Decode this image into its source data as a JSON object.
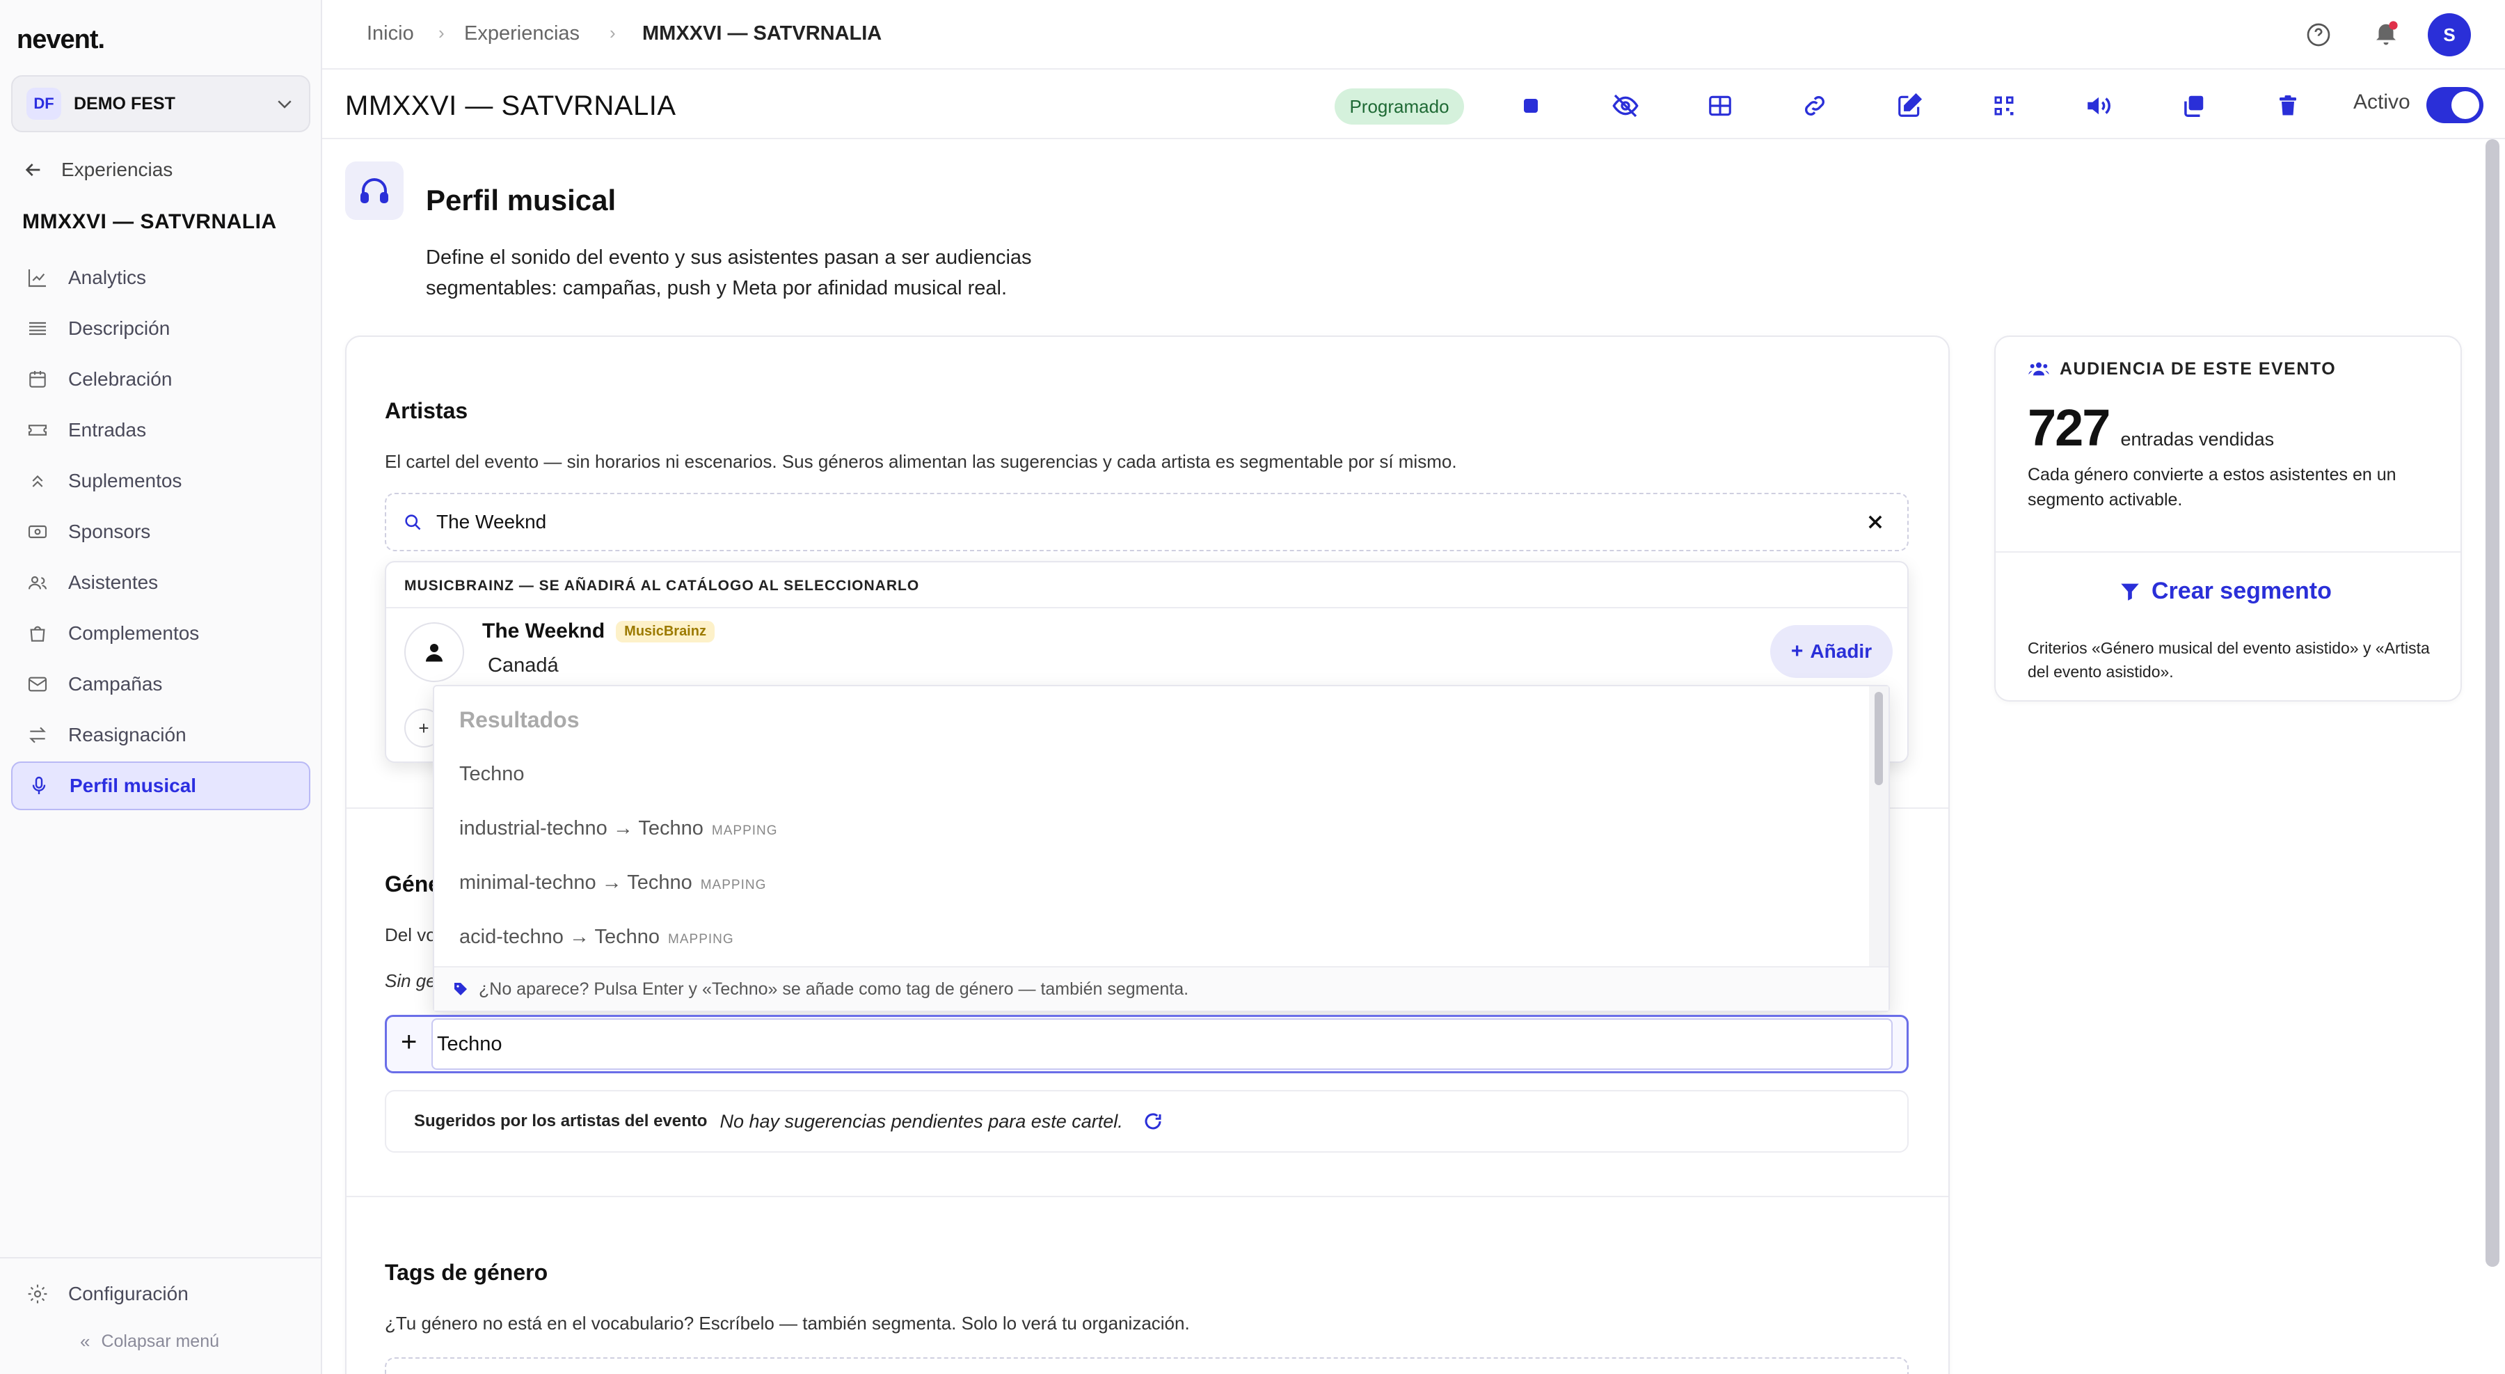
{
  "app": {
    "logo": "nevent."
  },
  "sidebar": {
    "org_initials": "DF",
    "org_name": "DEMO FEST",
    "back_label": "Experiencias",
    "event_title": "MMXXVI — SATVRNALIA",
    "items": [
      {
        "label": "Analytics",
        "icon": "chart-line-icon"
      },
      {
        "label": "Descripción",
        "icon": "list-icon"
      },
      {
        "label": "Celebración",
        "icon": "calendar-icon"
      },
      {
        "label": "Entradas",
        "icon": "ticket-icon"
      },
      {
        "label": "Suplementos",
        "icon": "chevrons-up-icon"
      },
      {
        "label": "Sponsors",
        "icon": "banknote-icon"
      },
      {
        "label": "Asistentes",
        "icon": "users-icon"
      },
      {
        "label": "Complementos",
        "icon": "bag-icon"
      },
      {
        "label": "Campañas",
        "icon": "mail-icon"
      },
      {
        "label": "Reasignación",
        "icon": "swap-icon"
      },
      {
        "label": "Perfil musical",
        "icon": "mic-icon",
        "active": true
      }
    ],
    "settings_label": "Configuración",
    "collapse_label": "Colapsar menú"
  },
  "breadcrumb": [
    "Inicio",
    "Experiencias",
    "MMXXVI — SATVRNALIA"
  ],
  "user_initial": "S",
  "titlebar": {
    "title": "MMXXVI — SATVRNALIA",
    "status": "Programado",
    "active_label": "Activo",
    "active": true,
    "tools": [
      "stop-icon",
      "eye-off-icon",
      "grid-icon",
      "link-icon",
      "edit-icon",
      "qr-icon",
      "speaker-icon",
      "copy-icon",
      "trash-icon"
    ]
  },
  "page": {
    "title": "Perfil musical",
    "lead": "Define el sonido del evento y sus asistentes pasan a ser audiencias segmentables: campañas, push y Meta por afinidad musical real."
  },
  "artists": {
    "title": "Artistas",
    "desc": "El cartel del evento — sin horarios ni escenarios. Sus géneros alimentan las sugerencias y cada artista es segmentable por sí mismo.",
    "search_value": "The Weeknd",
    "dropdown_header": "MUSICBRAINZ — SE AÑADIRÁ AL CATÁLOGO AL SELECCIONARLO",
    "result": {
      "name": "The Weeknd",
      "badge": "MusicBrainz",
      "country": "Canadá",
      "add_label": "Añadir"
    }
  },
  "genres": {
    "title_partial": "Géne",
    "desc_partial": "Del vo",
    "empty_partial": "Sin ge",
    "input_value": "Techno",
    "results_header": "Resultados",
    "results": [
      {
        "text": "Techno"
      },
      {
        "text": "industrial-techno → Techno",
        "tag": "MAPPING"
      },
      {
        "text": "minimal-techno → Techno",
        "tag": "MAPPING"
      },
      {
        "text": "acid-techno → Techno",
        "tag": "MAPPING"
      }
    ],
    "hint": "¿No aparece? Pulsa Enter y «Techno» se añade como tag de género — también segmenta.",
    "suggest_label": "Sugeridos por los artistas del evento",
    "suggest_empty": "No hay sugerencias pendientes para este cartel."
  },
  "tags": {
    "title": "Tags de género",
    "desc": "¿Tu género no está en el vocabulario? Escríbelo — también segmenta. Solo lo verá tu organización."
  },
  "audience": {
    "title": "AUDIENCIA DE ESTE EVENTO",
    "count": "727",
    "count_label": "entradas vendidas",
    "desc": "Cada género convierte a estos asistentes en un segmento activable.",
    "cta": "Crear segmento",
    "criteria": "Criterios «Género musical del evento asistido» y «Artista del evento asistido»."
  },
  "colors": {
    "accent": "#2a2fd8",
    "status_bg": "#d5f1dc",
    "badge_bg": "#fdf1c9"
  }
}
